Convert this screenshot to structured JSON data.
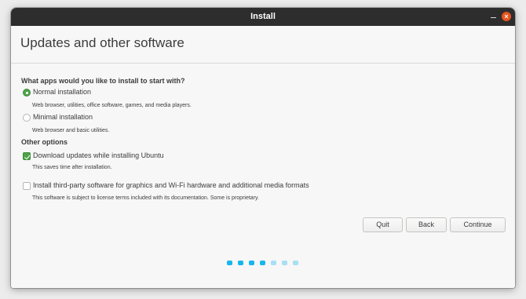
{
  "window": {
    "title": "Install"
  },
  "header": {
    "page_title": "Updates and other software"
  },
  "apps_section": {
    "question": "What apps would you like to install to start with?",
    "options": [
      {
        "label": "Normal installation",
        "description": "Web browser, utilities, office software, games, and media players.",
        "selected": true
      },
      {
        "label": "Minimal installation",
        "description": "Web browser and basic utilities.",
        "selected": false
      }
    ]
  },
  "other_options": {
    "heading": "Other options",
    "items": [
      {
        "label": "Download updates while installing Ubuntu",
        "description": "This saves time after installation.",
        "checked": true
      },
      {
        "label": "Install third-party software for graphics and Wi-Fi hardware and additional media formats",
        "description": "This software is subject to license terms included with its documentation. Some is proprietary.",
        "checked": false
      }
    ]
  },
  "buttons": {
    "quit": "Quit",
    "back": "Back",
    "continue": "Continue"
  },
  "progress": {
    "current_step": 4,
    "total_steps": 7,
    "active_color": "#19b6ee",
    "inactive_color": "#a8dff4"
  },
  "colors": {
    "titlebar": "#2e2d2d",
    "close_button": "#e95420",
    "checked_green": "#4fa44a"
  }
}
